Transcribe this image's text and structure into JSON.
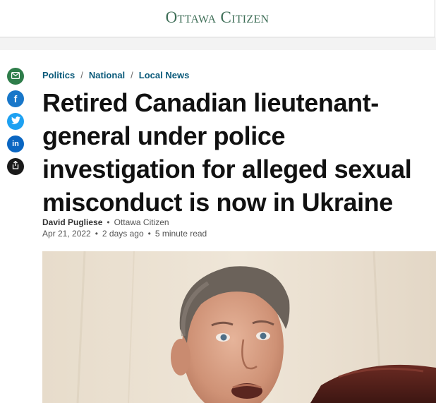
{
  "masthead": {
    "logo_text": "Ottawa Citizen"
  },
  "share": {
    "icons": [
      "email-icon",
      "facebook-icon",
      "twitter-icon",
      "linkedin-icon",
      "share-icon"
    ],
    "glyphs": {
      "facebook": "f",
      "linkedin": "in"
    }
  },
  "breadcrumb": {
    "items": [
      "Politics",
      "National",
      "Local News"
    ],
    "separator": "/"
  },
  "article": {
    "headline": "Retired Canadian lieutenant-general under police investigation for alleged sexual misconduct is now in Ukraine",
    "author": "David Pugliese",
    "publication": "Ottawa Citizen",
    "date": "Apr 21, 2022",
    "relative_time": "2 days ago",
    "read_time": "5 minute read",
    "meta_separator": "•"
  },
  "colors": {
    "brand_green": "#3e6e57",
    "breadcrumb_link": "#0a5a7a",
    "email": "#2e7d4a",
    "facebook": "#1877c9",
    "twitter": "#1da1f2",
    "linkedin": "#0a66c2",
    "share": "#1a1a1a"
  }
}
